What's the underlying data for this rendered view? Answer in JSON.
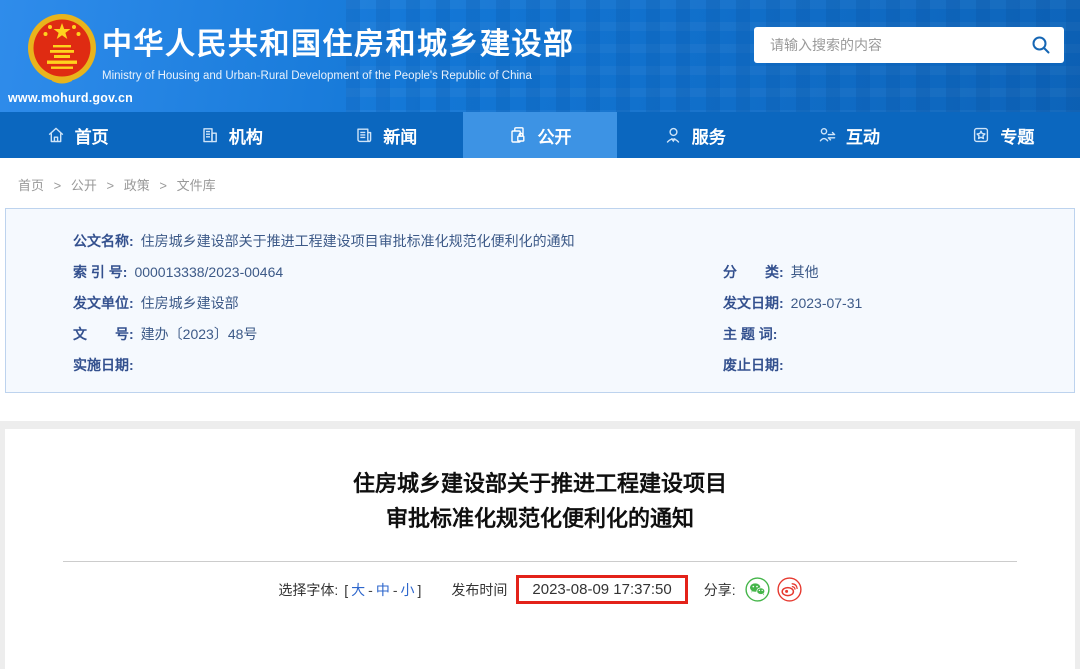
{
  "header": {
    "url": "www.mohurd.gov.cn",
    "title": "中华人民共和国住房和城乡建设部",
    "subtitle": "Ministry of Housing and Urban-Rural Development of the People's Republic of China",
    "search_placeholder": "请输入搜索的内容"
  },
  "nav": {
    "items": [
      {
        "label": "首页",
        "icon": "home-icon",
        "active": false
      },
      {
        "label": "机构",
        "icon": "organization-icon",
        "active": false
      },
      {
        "label": "新闻",
        "icon": "news-icon",
        "active": false
      },
      {
        "label": "公开",
        "icon": "disclosure-icon",
        "active": true
      },
      {
        "label": "服务",
        "icon": "service-icon",
        "active": false
      },
      {
        "label": "互动",
        "icon": "interaction-icon",
        "active": false
      },
      {
        "label": "专题",
        "icon": "topics-icon",
        "active": false
      }
    ]
  },
  "breadcrumb": {
    "sep": ">",
    "items": [
      "首页",
      "公开",
      "政策",
      "文件库"
    ]
  },
  "doc_info": {
    "name_label": "公文名称:",
    "name_value": "住房城乡建设部关于推进工程建设项目审批标准化规范化便利化的通知",
    "left": [
      {
        "label": "索 引 号:",
        "value": "000013338/2023-00464"
      },
      {
        "label": "发文单位:",
        "value": "住房城乡建设部"
      },
      {
        "label": "文　　号:",
        "value": "建办〔2023〕48号"
      },
      {
        "label": "实施日期:",
        "value": ""
      }
    ],
    "right": [
      {
        "label": "分　　类:",
        "value": "其他"
      },
      {
        "label": "发文日期:",
        "value": "2023-07-31"
      },
      {
        "label": "主 题 词:",
        "value": ""
      },
      {
        "label": "废止日期:",
        "value": ""
      }
    ]
  },
  "article": {
    "title_line1": "住房城乡建设部关于推进工程建设项目",
    "title_line2": "审批标准化规范化便利化的通知",
    "font_label": "选择字体:",
    "bracket_open": "[",
    "bracket_close": "]",
    "dash": "-",
    "font_sizes": [
      "大",
      "中",
      "小"
    ],
    "publish_label": "发布时间",
    "publish_time": "2023-08-09 17:37:50",
    "share_label": "分享:"
  },
  "colors": {
    "header_blue": "#1377d6",
    "nav_blue": "#0b67bf",
    "nav_active_blue": "#3d93e4",
    "doc_box_bg": "#f5f9fe",
    "doc_box_border": "#bdd3ee",
    "doc_label_blue": "#33508e",
    "highlight_red": "#e32219",
    "wechat_green": "#44b549",
    "weibo_red": "#e6392f",
    "link_blue": "#2d66cc"
  }
}
